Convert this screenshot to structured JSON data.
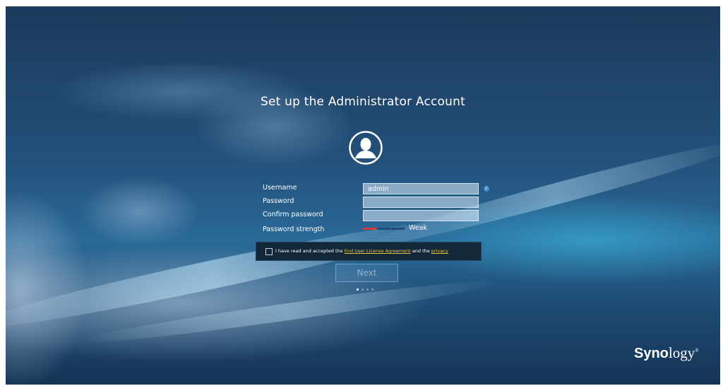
{
  "page": {
    "title": "Set up the Administrator Account"
  },
  "form": {
    "username_label": "Username",
    "username_value": "admin",
    "password_label": "Password",
    "password_value": "",
    "confirm_label": "Confirm password",
    "confirm_value": "",
    "strength_label": "Password strength",
    "strength_value": "Weak",
    "strength_level": 0.25
  },
  "eula": {
    "checked": false,
    "text_before": "I have read and accepted the ",
    "eula_link": "End User License Agreement",
    "text_middle": " and the ",
    "privacy_link": "privacy"
  },
  "actions": {
    "next_label": "Next",
    "step_current": 1,
    "step_total": 4
  },
  "brand": {
    "logo_bold": "Syno",
    "logo_rest": "logy",
    "logo_mark": "®"
  },
  "icons": [
    "user-avatar-icon",
    "info-icon",
    "checkbox-icon"
  ],
  "colors": {
    "link": "#e8c640",
    "strength_weak": "#d63a3a",
    "info": "#4a8fd6"
  }
}
